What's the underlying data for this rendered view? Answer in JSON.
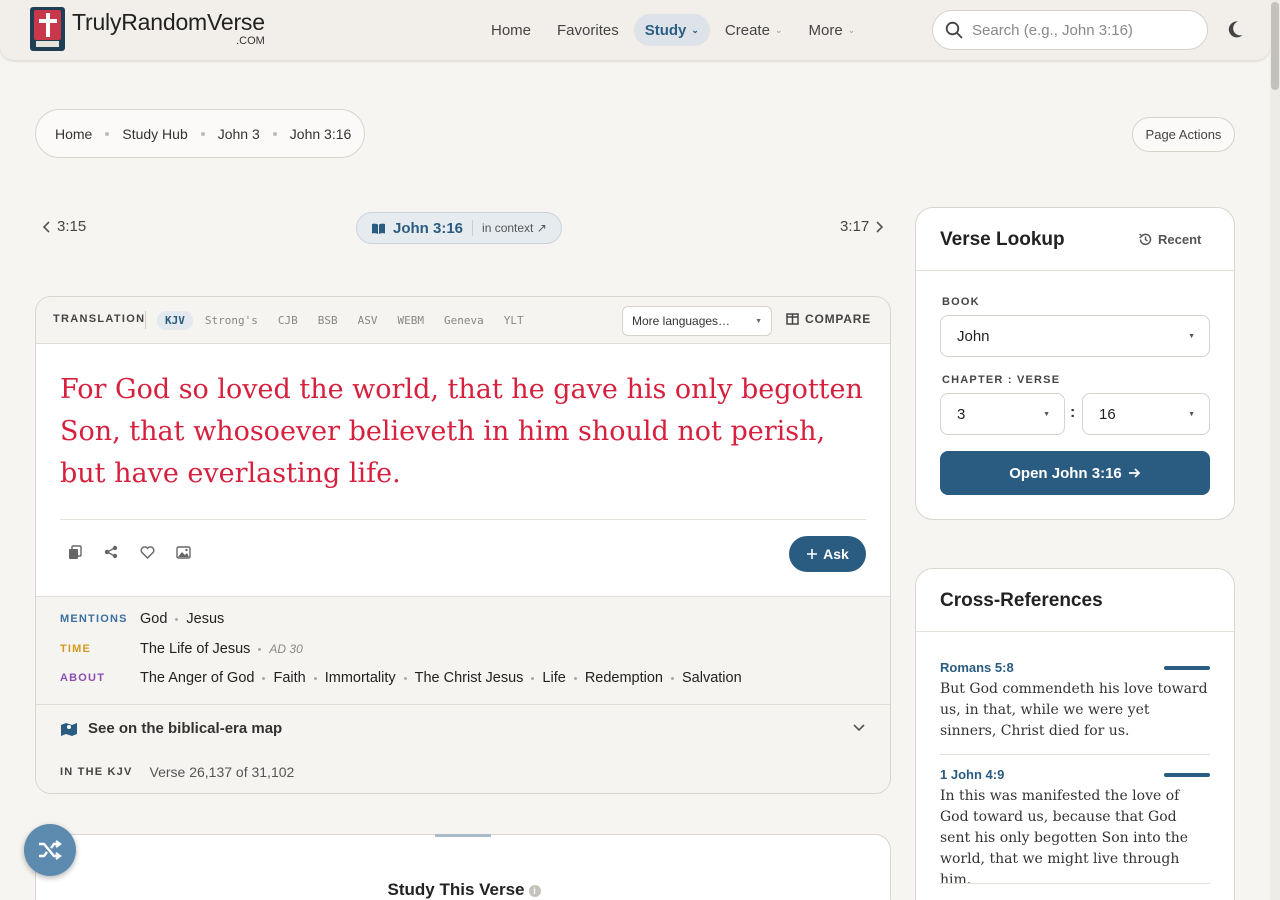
{
  "header": {
    "brand_name": "TrulyRandomVerse",
    "brand_suffix": ".COM",
    "nav": [
      {
        "label": "Home",
        "has_dropdown": false,
        "active": false
      },
      {
        "label": "Favorites",
        "has_dropdown": false,
        "active": false
      },
      {
        "label": "Study",
        "has_dropdown": true,
        "active": true
      },
      {
        "label": "Create",
        "has_dropdown": true,
        "active": false
      },
      {
        "label": "More",
        "has_dropdown": true,
        "active": false
      }
    ],
    "search_placeholder": "Search (e.g., John 3:16)",
    "theme_icon": "moon-icon"
  },
  "breadcrumb": [
    "Home",
    "Study Hub",
    "John 3",
    "John 3:16"
  ],
  "page_actions_label": "Page Actions",
  "verse_nav": {
    "prev": "3:15",
    "next": "3:17",
    "current": "John 3:16",
    "context_label": "in context ↗"
  },
  "translation_bar": {
    "label": "TRANSLATION",
    "translations": [
      "KJV",
      "Strong's",
      "CJB",
      "BSB",
      "ASV",
      "WEBM",
      "Geneva",
      "YLT"
    ],
    "active": "KJV",
    "more_languages": "More languages…",
    "compare_label": "COMPARE"
  },
  "verse_text": "For God so loved the world, that he gave his only begotten Son, that whosoever believeth in him should not perish, but have everlasting life.",
  "verse_actions": [
    "copy-icon",
    "share-icon",
    "heart-icon",
    "image-icon"
  ],
  "ask_label": "Ask",
  "meta": {
    "mentions": {
      "label": "MENTIONS",
      "items": [
        "God",
        "Jesus"
      ]
    },
    "time": {
      "label": "TIME",
      "value": "The Life of Jesus",
      "era": "AD 30"
    },
    "about": {
      "label": "ABOUT",
      "items": [
        "The Anger of God",
        "Faith",
        "Immortality",
        "The Christ Jesus",
        "Life",
        "Redemption",
        "Salvation"
      ]
    }
  },
  "map_label": "See on the biblical-era map",
  "kjv_position": {
    "label": "IN THE KJV",
    "value": "Verse 26,137 of 31,102"
  },
  "study_title": "Study This Verse",
  "lookup": {
    "title": "Verse Lookup",
    "recent_label": "Recent",
    "book_label": "BOOK",
    "book_value": "John",
    "chapter_verse_label": "CHAPTER : VERSE",
    "chapter_value": "3",
    "verse_value": "16",
    "open_button": "Open John 3:16"
  },
  "cross_references": {
    "title": "Cross-References",
    "items": [
      {
        "ref": "Romans 5:8",
        "text": "But God commendeth his love toward us, in that, while we were yet sinners, Christ died for us."
      },
      {
        "ref": "1 John 4:9",
        "text": "In this was manifested the love of God toward us, because that God sent his only begotten Son into the world, that we might live through him."
      }
    ]
  },
  "colors": {
    "accent": "#2a5c82",
    "verse_red": "#d6203d",
    "background": "#f7f5f1"
  }
}
